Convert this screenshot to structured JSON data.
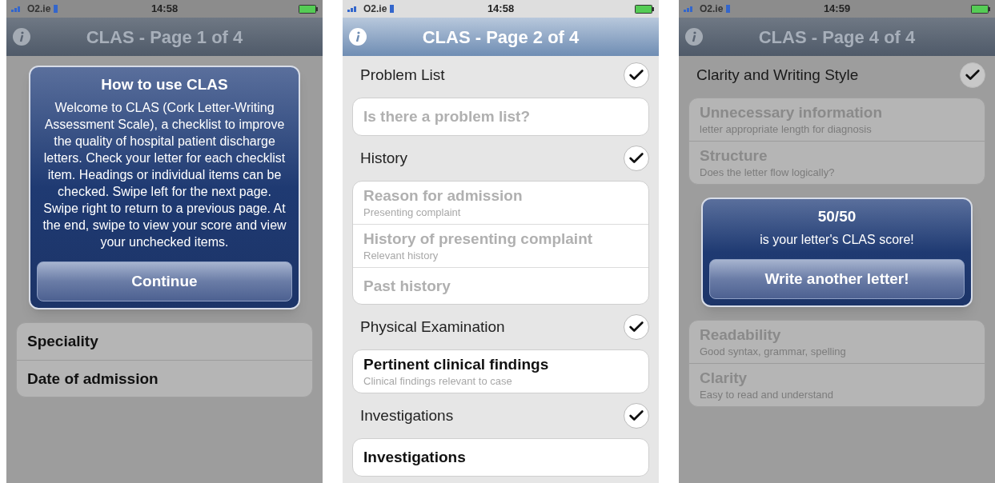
{
  "screens": [
    {
      "status": {
        "carrier": "O2.ie",
        "time": "14:58"
      },
      "title": "CLAS - Page 1 of 4",
      "items": [
        {
          "kind": "alert",
          "title": "How to use CLAS",
          "message": "Welcome to CLAS (Cork Letter-Writing Assessment Scale), a checklist to improve the quality of hospital patient discharge letters. Check your letter for each checklist item. Headings or individual items can be checked. Swipe left for the next page. Swipe right to return to a previous page. At the end, swipe to view your score and view your unchecked items.",
          "button": "Continue"
        },
        {
          "kind": "group",
          "rows": [
            {
              "title": "Speciality",
              "checked": false
            },
            {
              "title": "Date of admission",
              "checked": false
            }
          ]
        }
      ]
    },
    {
      "status": {
        "carrier": "O2.ie",
        "time": "14:58"
      },
      "title": "CLAS - Page 2 of 4",
      "items": [
        {
          "kind": "header",
          "label": "Problem List",
          "checked": true
        },
        {
          "kind": "group",
          "rows": [
            {
              "title": "Is there a problem list?",
              "checked": true
            }
          ]
        },
        {
          "kind": "header",
          "label": "History",
          "checked": true
        },
        {
          "kind": "group",
          "rows": [
            {
              "title": "Reason for admission",
              "subtitle": "Presenting complaint",
              "checked": true
            },
            {
              "title": "History of presenting complaint",
              "subtitle": "Relevant history",
              "checked": true
            },
            {
              "title": "Past history",
              "checked": true
            }
          ]
        },
        {
          "kind": "header",
          "label": "Physical Examination",
          "checked": true
        },
        {
          "kind": "group",
          "rows": [
            {
              "title": "Pertinent clinical findings",
              "subtitle": "Clinical findings relevant to case",
              "checked": false
            }
          ]
        },
        {
          "kind": "header",
          "label": "Investigations",
          "checked": true
        },
        {
          "kind": "group",
          "rows": [
            {
              "title": "Investigations",
              "checked": false
            }
          ]
        }
      ]
    },
    {
      "status": {
        "carrier": "O2.ie",
        "time": "14:59"
      },
      "title": "CLAS - Page 4 of 4",
      "items": [
        {
          "kind": "header",
          "label": "Clarity and Writing Style",
          "checked": true
        },
        {
          "kind": "group",
          "rows": [
            {
              "title": "Unnecessary information",
              "subtitle": "letter appropriate length for diagnosis",
              "checked": true
            },
            {
              "title": "Structure",
              "subtitle": "Does the letter flow logically?",
              "checked": true
            }
          ]
        },
        {
          "kind": "alert",
          "title": "50/50",
          "message": "is your letter's CLAS score!",
          "button": "Write another letter!"
        },
        {
          "kind": "group",
          "rows": [
            {
              "title": "Readability",
              "subtitle": "Good syntax, grammar, spelling",
              "checked": true
            },
            {
              "title": "Clarity",
              "subtitle": "Easy to read and understand",
              "checked": true
            }
          ]
        }
      ]
    }
  ]
}
